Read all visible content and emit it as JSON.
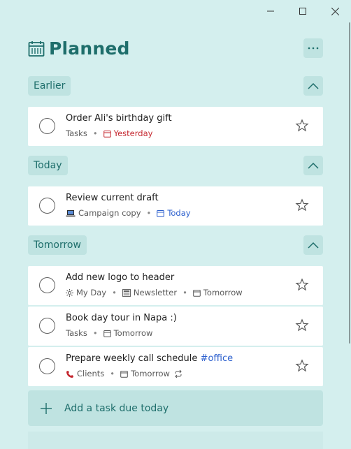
{
  "window": {
    "controls": [
      "minimize",
      "maximize",
      "close"
    ]
  },
  "header": {
    "title": "Planned",
    "icon": "calendar-icon",
    "more_icon": "more-icon"
  },
  "colors": {
    "background": "#d4efee",
    "accent": "#1e6e6b",
    "section_bg": "#bfe3e1",
    "overdue": "#c4262e",
    "today": "#2b5fce"
  },
  "sections": {
    "earlier": {
      "label": "Earlier",
      "tasks": [
        {
          "title": "Order Ali's birthday gift",
          "list": "Tasks",
          "due": "Yesterday"
        }
      ]
    },
    "today": {
      "label": "Today",
      "tasks": [
        {
          "title": "Review current draft",
          "list": "Campaign copy",
          "due": "Today"
        }
      ]
    },
    "tomorrow": {
      "label": "Tomorrow",
      "tasks": [
        {
          "title": "Add new logo to header",
          "myday": "My Day",
          "list": "Newsletter",
          "due": "Tomorrow"
        },
        {
          "title": "Book day tour in Napa :)",
          "list": "Tasks",
          "due": "Tomorrow"
        },
        {
          "title": "Prepare weekly call schedule",
          "tag": "#office",
          "list": "Clients",
          "due": "Tomorrow"
        }
      ]
    }
  },
  "add_task": {
    "label": "Add a task due today"
  }
}
